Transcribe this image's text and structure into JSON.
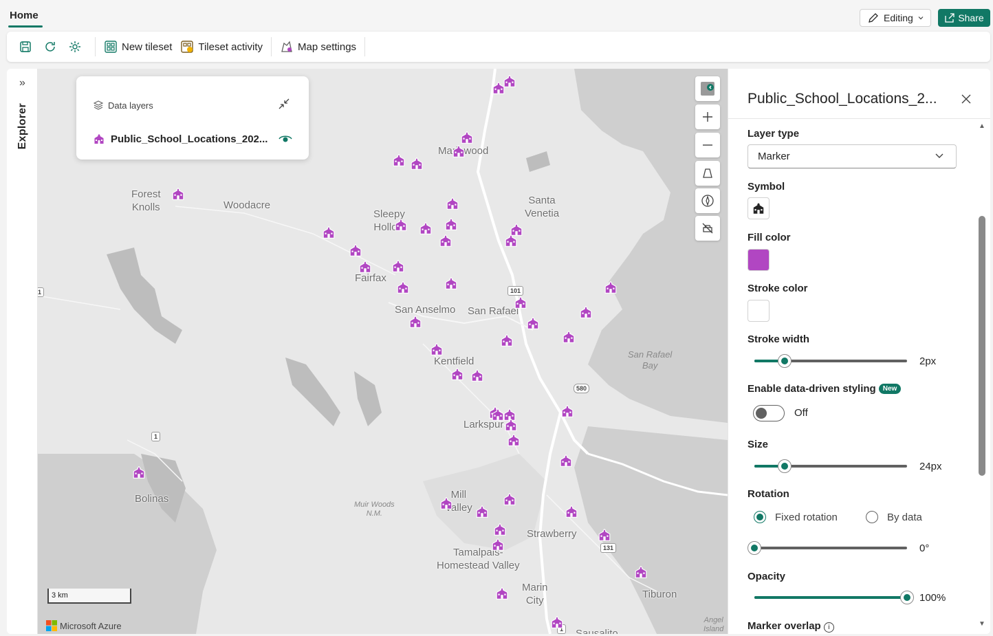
{
  "header": {
    "home_tab": "Home",
    "editing_label": "Editing",
    "share_label": "Share"
  },
  "toolbar": {
    "new_tileset": "New tileset",
    "tileset_activity": "Tileset activity",
    "map_settings": "Map settings"
  },
  "explorer": {
    "label": "Explorer"
  },
  "data_layers": {
    "title": "Data layers",
    "layer_name": "Public_School_Locations_202..."
  },
  "map": {
    "places": {
      "marinwood": "Marinwood",
      "forest_knolls_1": "Forest",
      "forest_knolls_2": "Knolls",
      "woodacre": "Woodacre",
      "sleepy_hollow_1": "Sleepy",
      "sleepy_hollow_2": "Hollow",
      "santa_venetia_1": "Santa",
      "santa_venetia_2": "Venetia",
      "fairfax": "Fairfax",
      "san_anselmo": "San Anselmo",
      "san_rafael": "San Rafael",
      "kentfield": "Kentfield",
      "larkspur": "Larkspur",
      "bolinas": "Bolinas",
      "mill_valley_1": "Mill",
      "mill_valley_2": "Valley",
      "strawberry": "Strawberry",
      "tamalpais_1": "Tamalpais-",
      "tamalpais_2": "Homestead Valley",
      "marin_city_1": "Marin",
      "marin_city_2": "City",
      "tiburon": "Tiburon",
      "sausalito": "Sausalito"
    },
    "water": {
      "san_rafael_bay_1": "San Rafael",
      "san_rafael_bay_2": "Bay"
    },
    "small": {
      "muir_woods_1": "Muir Woods",
      "muir_woods_2": "N.M.",
      "angel_island_1": "Angel",
      "angel_island_2": "Island"
    },
    "shields": {
      "us101": "101",
      "i580": "580",
      "ca1_a": "1",
      "ca1_b": "1",
      "ca1_c": "1",
      "ca131": "131"
    },
    "scale": "3 km",
    "attribution": "Microsoft Azure"
  },
  "panel": {
    "title": "Public_School_Locations_2...",
    "layer_type_label": "Layer type",
    "layer_type_value": "Marker",
    "symbol_label": "Symbol",
    "fill_color_label": "Fill color",
    "fill_color": "#b146c2",
    "stroke_color_label": "Stroke color",
    "stroke_color": "#ffffff",
    "stroke_width_label": "Stroke width",
    "stroke_width_value": "2px",
    "data_driven_label": "Enable data-driven styling",
    "new_badge": "New",
    "toggle_state": "Off",
    "size_label": "Size",
    "size_value": "24px",
    "rotation_label": "Rotation",
    "rotation_fixed": "Fixed rotation",
    "rotation_by_data": "By data",
    "rotation_value": "0°",
    "opacity_label": "Opacity",
    "opacity_value": "100%",
    "marker_overlap_label": "Marker overlap"
  },
  "colors": {
    "accent": "#117865",
    "marker": "#b146c2"
  }
}
